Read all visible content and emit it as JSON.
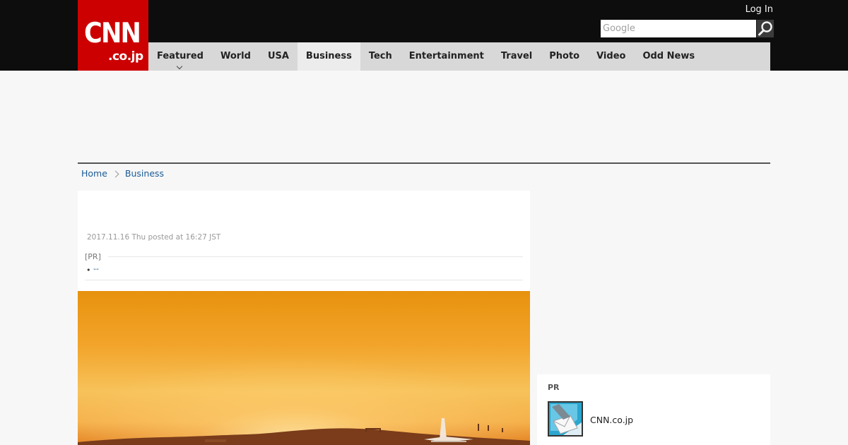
{
  "header": {
    "logo_main": "CNN",
    "logo_sub": ".co.jp",
    "login_label": "Log In"
  },
  "search": {
    "placeholder": "Google",
    "button_icon": "search-icon"
  },
  "nav": {
    "items": [
      {
        "label": "Featured",
        "has_dropdown": true
      },
      {
        "label": "World"
      },
      {
        "label": "USA"
      },
      {
        "label": "Business",
        "active": true
      },
      {
        "label": "Tech"
      },
      {
        "label": "Entertainment"
      },
      {
        "label": "Travel"
      },
      {
        "label": "Photo"
      },
      {
        "label": "Video"
      },
      {
        "label": "Odd News"
      }
    ]
  },
  "breadcrumb": {
    "items": [
      {
        "label": "Home"
      },
      {
        "label": "Business"
      }
    ]
  },
  "article": {
    "date": "2017.11.16 Thu posted at 16:27 JST",
    "pr_label": "[PR]",
    "pr_link": "--",
    "hero_image": "airplane-at-sunset"
  },
  "sidebar_pr": {
    "title": "PR",
    "item_label": "CNN.co.jp",
    "item_icon": "mail-icon"
  },
  "colors": {
    "brand_red": "#cc0000",
    "topbar": "#0d0d0d",
    "nav_bg": "#d8d8d8",
    "link": "#1a5a96"
  }
}
